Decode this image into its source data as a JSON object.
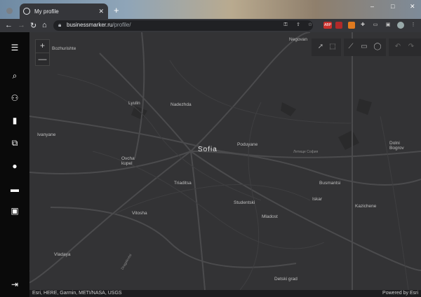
{
  "browser": {
    "tab_title": "My profile",
    "new_tab_icon": "+",
    "url_host": "businessmarker.ru",
    "url_path": "/profile/",
    "window_controls": [
      "–",
      "□",
      "✕"
    ]
  },
  "sidebar": {
    "items": [
      "menu-icon",
      "search-icon",
      "user-icon",
      "cube-icon",
      "layers-icon",
      "coin-icon",
      "monitor-icon",
      "contact-card-icon",
      "logout-icon"
    ]
  },
  "map": {
    "zoom_in": "+",
    "zoom_out": "—",
    "labels": {
      "bozhurishte": "Bozhurishte",
      "negovan": "Negovan",
      "lyulin": "Lyulin",
      "nadezhda": "Nadezhda",
      "ivanyane": "Ivanyane",
      "sofia": "Sofia",
      "poduyane": "Poduyane",
      "letishte": "Летище София",
      "dolni_bogrov": "Dolni\nBogrov",
      "ovcha_kupel": "Ovcha\nkupel",
      "triaditsa": "Triaditsa",
      "busmantsi": "Busmantsi",
      "iskar": "Iskar",
      "kazichene": "Kazichene",
      "studentski": "Studentski",
      "vitosha": "Vitosha",
      "mladost": "Mladost",
      "vladaya": "Vladaya",
      "dragalevtsi": "Dragalevtsi",
      "detski_grad": "Detski grad"
    }
  },
  "footer": {
    "attribution": "Esri, HERE, Garmin, METI/NASA, USGS",
    "powered_by": "Powered by Esri"
  },
  "colors": {
    "sidebar": "#0a0a0a",
    "map_bg": "#333335",
    "road": "#4a4a4c",
    "browser_bar": "#35363a"
  }
}
